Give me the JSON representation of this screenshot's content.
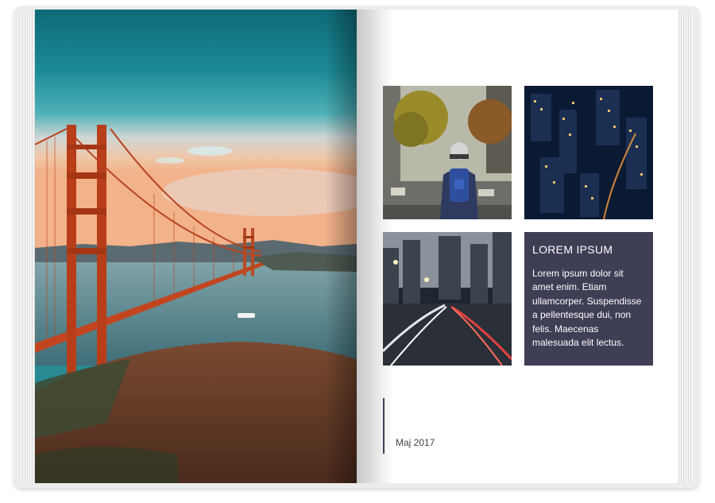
{
  "book": {
    "left_page": {
      "photo": "golden-gate-bridge-photo"
    },
    "right_page": {
      "photos": [
        "backpacker-street-photo",
        "city-night-aerial-photo",
        "traffic-light-trails-photo"
      ],
      "card": {
        "heading": "LOREM IPSUM",
        "body": "Lorem ipsum dolor sit amet enim. Etiam ullamcorper. Suspendisse a pellentesque dui, non felis. Maecenas malesuada elit lectus."
      },
      "date": "Maj 2017"
    }
  },
  "colors": {
    "card_background": "#3e3e55",
    "page": "#ffffff",
    "sky": "#1c8b96"
  }
}
